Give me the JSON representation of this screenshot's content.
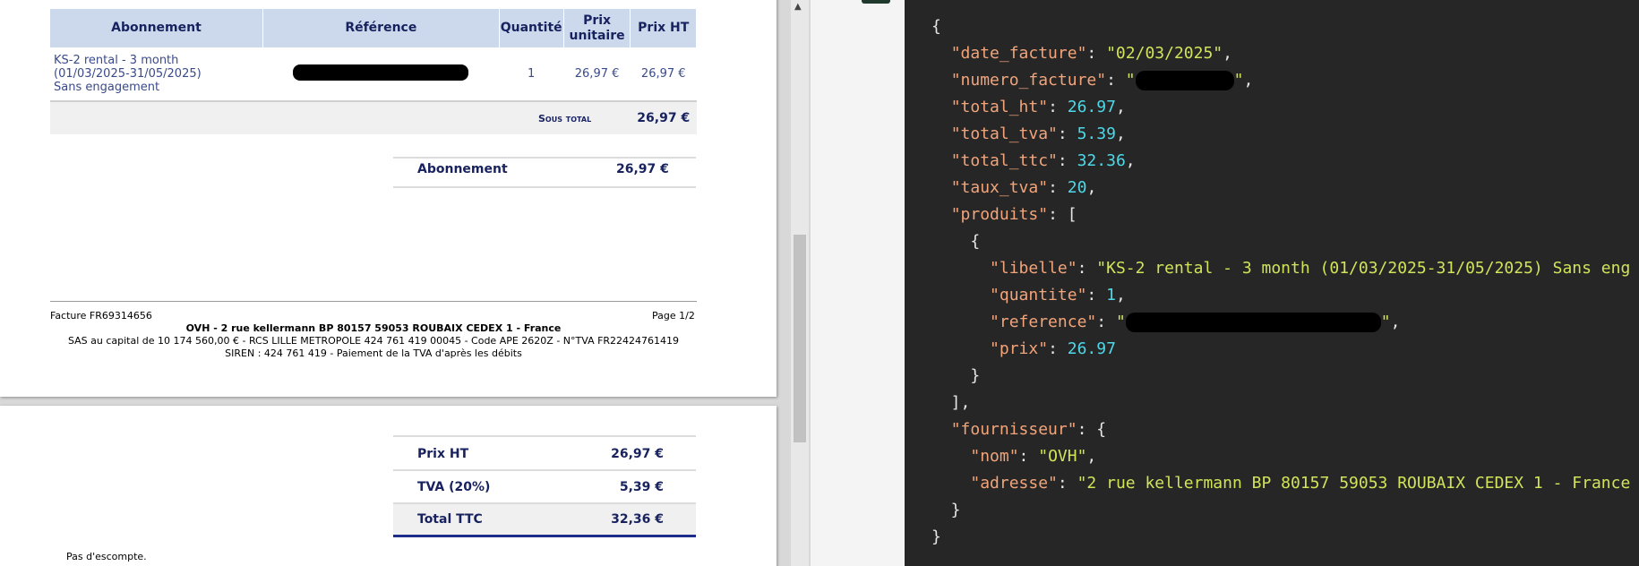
{
  "invoice": {
    "columns": [
      "Abonnement",
      "Référence",
      "Quantité",
      "Prix unitaire",
      "Prix HT"
    ],
    "line": {
      "description_1": "KS-2 rental - 3 month",
      "description_2": "(01/03/2025-31/05/2025)",
      "description_3": "Sans engagement",
      "quantity": "1",
      "unit_price": "26,97 €",
      "price_ht": "26,97 €"
    },
    "subtotal_label": "Sous total",
    "subtotal_value": "26,97 €",
    "summary_label": "Abonnement",
    "summary_value": "26,97 €",
    "footer": {
      "invoice_ref": "Facture FR69314656",
      "page": "Page 1/2",
      "company": "OVH - 2 rue kellermann BP 80157 59053 ROUBAIX CEDEX 1 - France",
      "legal": "SAS au capital de 10 174 560,00 € - RCS LILLE METROPOLE 424 761 419 00045 - Code APE 2620Z - N°TVA FR22424761419",
      "siren": "SIREN : 424 761 419 - Paiement de la TVA d'après les débits"
    },
    "totals": [
      {
        "label": "Prix HT",
        "value": "26,97 €"
      },
      {
        "label": "TVA (20%)",
        "value": "5,39 €"
      },
      {
        "label": "Total TTC",
        "value": "32,36 €"
      }
    ],
    "discount_note": "Pas d'escompte."
  },
  "json_panel": {
    "lines": [
      "{",
      "  \"date_facture\": \"02/03/2025\",",
      "  \"numero_facture\": \"[REDACTED]\",",
      "  \"total_ht\": 26.97,",
      "  \"total_tva\": 5.39,",
      "  \"total_ttc\": 32.36,",
      "  \"taux_tva\": 20,",
      "  \"produits\": [",
      "    {",
      "      \"libelle\": \"KS-2 rental - 3 month (01/03/2025-31/05/2025) Sans eng",
      "      \"quantite\": 1,",
      "      \"reference\": \"[REDACTED]\",",
      "      \"prix\": 26.97",
      "    }",
      "  ],",
      "  \"fournisseur\": {",
      "    \"nom\": \"OVH\",",
      "    \"adresse\": \"2 rue kellermann BP 80157 59053 ROUBAIX CEDEX 1 - France",
      "  }",
      "}"
    ]
  }
}
